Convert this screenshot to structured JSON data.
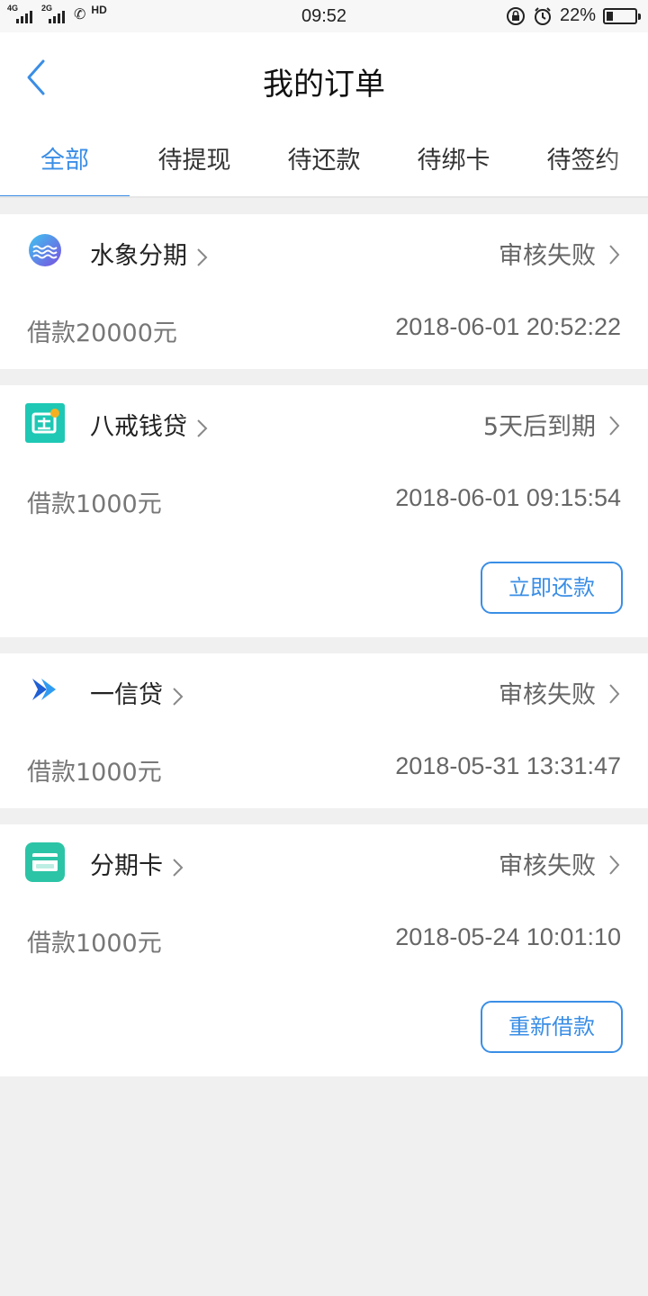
{
  "status_bar": {
    "network_left": "4G",
    "network_right": "2G",
    "hd": "HD",
    "time": "09:52",
    "battery_text": "22%",
    "battery_level": 0.22
  },
  "header": {
    "title": "我的订单"
  },
  "tabs": [
    {
      "label": "全部",
      "active": true
    },
    {
      "label": "待提现",
      "active": false
    },
    {
      "label": "待还款",
      "active": false
    },
    {
      "label": "待绑卡",
      "active": false
    },
    {
      "label": "待签约",
      "active": false
    }
  ],
  "orders": [
    {
      "name": "水象分期",
      "logo_icon": "water-wave-icon",
      "status": "审核失败",
      "amount": "借款20000元",
      "datetime": "2018-06-01 20:52:22"
    },
    {
      "name": "八戒钱贷",
      "logo_icon": "loan-icon",
      "status": "5天后到期",
      "amount": "借款1000元",
      "datetime": "2018-06-01 09:15:54",
      "action": "立即还款"
    },
    {
      "name": "一信贷",
      "logo_icon": "arrow-logo-icon",
      "status": "审核失败",
      "amount": "借款1000元",
      "datetime": "2018-05-31 13:31:47"
    },
    {
      "name": "分期卡",
      "logo_icon": "card-icon",
      "status": "审核失败",
      "amount": "借款1000元",
      "datetime": "2018-05-24 10:01:10",
      "action": "重新借款"
    }
  ],
  "colors": {
    "accent": "#3a8ee6",
    "background": "#f0f0f0"
  }
}
